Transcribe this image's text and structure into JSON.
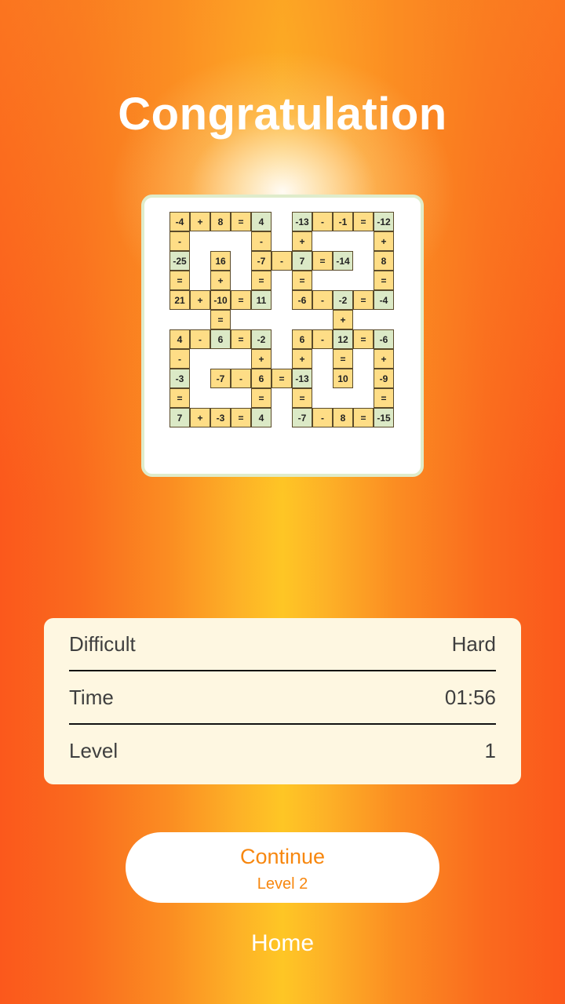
{
  "title": "Congratulation",
  "colors": {
    "number_cell": "#fedd86",
    "result_cell": "#dbe9c6",
    "button_text": "#f7870f",
    "stats_bg": "#fef7e1"
  },
  "board": {
    "rows": [
      [
        [
          "-4",
          "y"
        ],
        [
          "+",
          "y"
        ],
        [
          "8",
          "y"
        ],
        [
          "=",
          "y"
        ],
        [
          "4",
          "g"
        ],
        [
          "",
          ""
        ],
        [
          "-13",
          "g"
        ],
        [
          "-",
          "y"
        ],
        [
          "-1",
          "y"
        ],
        [
          "=",
          "y"
        ],
        [
          "-12",
          "g"
        ]
      ],
      [
        [
          "-",
          "y"
        ],
        [
          "",
          ""
        ],
        [
          "",
          ""
        ],
        [
          "",
          ""
        ],
        [
          "-",
          "y"
        ],
        [
          "",
          ""
        ],
        [
          "+",
          "y"
        ],
        [
          "",
          ""
        ],
        [
          "",
          ""
        ],
        [
          "",
          ""
        ],
        [
          "+",
          "y"
        ]
      ],
      [
        [
          "-25",
          "g"
        ],
        [
          "",
          ""
        ],
        [
          "16",
          "y"
        ],
        [
          "",
          ""
        ],
        [
          "-7",
          "y"
        ],
        [
          "-",
          "y"
        ],
        [
          "7",
          "g"
        ],
        [
          "=",
          "y"
        ],
        [
          "-14",
          "g"
        ],
        [
          "",
          ""
        ],
        [
          "8",
          "y"
        ]
      ],
      [
        [
          "=",
          "y"
        ],
        [
          "",
          ""
        ],
        [
          "+",
          "y"
        ],
        [
          "",
          ""
        ],
        [
          "=",
          "y"
        ],
        [
          "",
          ""
        ],
        [
          "=",
          "y"
        ],
        [
          "",
          ""
        ],
        [
          "",
          ""
        ],
        [
          "",
          ""
        ],
        [
          "=",
          "y"
        ]
      ],
      [
        [
          "21",
          "y"
        ],
        [
          "+",
          "y"
        ],
        [
          "-10",
          "y"
        ],
        [
          "=",
          "y"
        ],
        [
          "11",
          "g"
        ],
        [
          "",
          ""
        ],
        [
          "-6",
          "y"
        ],
        [
          "-",
          "y"
        ],
        [
          "-2",
          "g"
        ],
        [
          "=",
          "y"
        ],
        [
          "-4",
          "g"
        ]
      ],
      [
        [
          "",
          ""
        ],
        [
          "",
          ""
        ],
        [
          "=",
          "y"
        ],
        [
          "",
          ""
        ],
        [
          "",
          ""
        ],
        [
          "",
          ""
        ],
        [
          "",
          ""
        ],
        [
          "",
          ""
        ],
        [
          "+",
          "y"
        ],
        [
          "",
          ""
        ],
        [
          "",
          ""
        ]
      ],
      [
        [
          "4",
          "y"
        ],
        [
          "-",
          "y"
        ],
        [
          "6",
          "g"
        ],
        [
          "=",
          "y"
        ],
        [
          "-2",
          "g"
        ],
        [
          "",
          ""
        ],
        [
          "6",
          "y"
        ],
        [
          "-",
          "y"
        ],
        [
          "12",
          "g"
        ],
        [
          "=",
          "y"
        ],
        [
          "-6",
          "g"
        ]
      ],
      [
        [
          "-",
          "y"
        ],
        [
          "",
          ""
        ],
        [
          "",
          ""
        ],
        [
          "",
          ""
        ],
        [
          "+",
          "y"
        ],
        [
          "",
          ""
        ],
        [
          "+",
          "y"
        ],
        [
          "",
          ""
        ],
        [
          "=",
          "y"
        ],
        [
          "",
          ""
        ],
        [
          "+",
          "y"
        ]
      ],
      [
        [
          "-3",
          "g"
        ],
        [
          "",
          ""
        ],
        [
          "-7",
          "y"
        ],
        [
          "-",
          "y"
        ],
        [
          "6",
          "y"
        ],
        [
          "=",
          "y"
        ],
        [
          "-13",
          "g"
        ],
        [
          "",
          ""
        ],
        [
          "10",
          "y"
        ],
        [
          "",
          ""
        ],
        [
          "-9",
          "y"
        ]
      ],
      [
        [
          "=",
          "y"
        ],
        [
          "",
          ""
        ],
        [
          "",
          ""
        ],
        [
          "",
          ""
        ],
        [
          "=",
          "y"
        ],
        [
          "",
          ""
        ],
        [
          "=",
          "y"
        ],
        [
          "",
          ""
        ],
        [
          "",
          ""
        ],
        [
          "",
          ""
        ],
        [
          "=",
          "y"
        ]
      ],
      [
        [
          "7",
          "g"
        ],
        [
          "+",
          "y"
        ],
        [
          "-3",
          "y"
        ],
        [
          "=",
          "y"
        ],
        [
          "4",
          "g"
        ],
        [
          "",
          ""
        ],
        [
          "-7",
          "g"
        ],
        [
          "-",
          "y"
        ],
        [
          "8",
          "y"
        ],
        [
          "=",
          "y"
        ],
        [
          "-15",
          "g"
        ]
      ]
    ]
  },
  "stats": [
    {
      "label": "Difficult",
      "value": "Hard"
    },
    {
      "label": "Time",
      "value": "01:56"
    },
    {
      "label": "Level",
      "value": "1"
    }
  ],
  "continue_button": {
    "label": "Continue",
    "sublabel": "Level 2"
  },
  "home_button": {
    "label": "Home"
  }
}
